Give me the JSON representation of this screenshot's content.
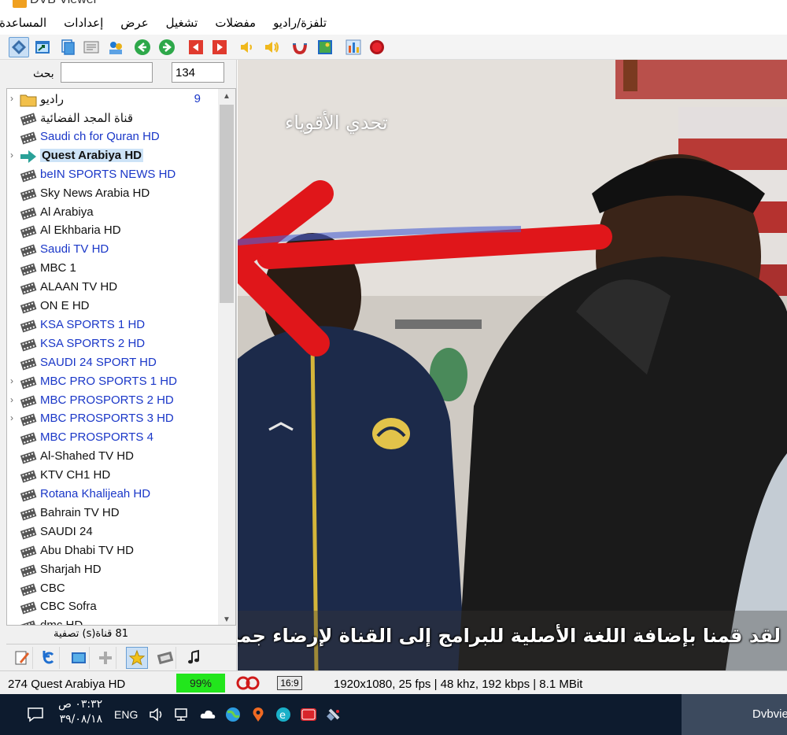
{
  "window": {
    "title": "DVB Viewer"
  },
  "menu": {
    "items": [
      "تلفزة/راديو",
      "مفضلات",
      "تشغيل",
      "عرض",
      "إعدادات",
      "المساعدة"
    ]
  },
  "toolbar": {
    "buttons": [
      {
        "icon": "channel-list-icon"
      },
      {
        "icon": "window-icon"
      },
      {
        "icon": "copy-icon"
      },
      {
        "icon": "teletext-icon"
      },
      {
        "icon": "users-icon"
      },
      {
        "icon": "back-icon"
      },
      {
        "icon": "forward-icon"
      },
      {
        "icon": "previous-icon"
      },
      {
        "icon": "next-icon"
      },
      {
        "icon": "volume-down-icon"
      },
      {
        "icon": "volume-up-icon"
      },
      {
        "icon": "magnet-icon"
      },
      {
        "icon": "picture-icon"
      },
      {
        "icon": "equalizer-icon"
      },
      {
        "icon": "record-icon"
      }
    ]
  },
  "search": {
    "label": "بحث",
    "value": "",
    "count_value": "134"
  },
  "channels": {
    "folder": {
      "name": "راديو",
      "count": "9"
    },
    "items": [
      {
        "name": "قناة المجد الفضائية",
        "color": "black",
        "arrow": false,
        "selected": false
      },
      {
        "name": "Saudi ch for Quran HD",
        "color": "blue",
        "arrow": false,
        "selected": false
      },
      {
        "name": "Quest Arabiya HD",
        "color": "black",
        "arrow": true,
        "selected": true
      },
      {
        "name": "beIN SPORTS NEWS HD",
        "color": "blue",
        "arrow": false,
        "selected": false
      },
      {
        "name": "Sky News Arabia HD",
        "color": "black",
        "arrow": false,
        "selected": false
      },
      {
        "name": "Al Arabiya",
        "color": "black",
        "arrow": false,
        "selected": false
      },
      {
        "name": "Al Ekhbaria HD",
        "color": "black",
        "arrow": false,
        "selected": false
      },
      {
        "name": "Saudi TV HD",
        "color": "blue",
        "arrow": false,
        "selected": false
      },
      {
        "name": "MBC 1",
        "color": "black",
        "arrow": false,
        "selected": false
      },
      {
        "name": "ALAAN TV HD",
        "color": "black",
        "arrow": false,
        "selected": false
      },
      {
        "name": "ON  E HD",
        "color": "black",
        "arrow": false,
        "selected": false
      },
      {
        "name": "KSA SPORTS 1 HD",
        "color": "blue",
        "arrow": false,
        "selected": false
      },
      {
        "name": "KSA SPORTS 2 HD",
        "color": "blue",
        "arrow": false,
        "selected": false
      },
      {
        "name": "SAUDI 24 SPORT HD",
        "color": "blue",
        "arrow": false,
        "selected": false
      },
      {
        "name": "MBC PRO SPORTS 1 HD",
        "color": "blue",
        "arrow": true,
        "selected": false
      },
      {
        "name": "MBC PROSPORTS 2 HD",
        "color": "blue",
        "arrow": true,
        "selected": false
      },
      {
        "name": "MBC PROSPORTS 3 HD",
        "color": "blue",
        "arrow": true,
        "selected": false
      },
      {
        "name": "MBC PROSPORTS 4",
        "color": "blue",
        "arrow": false,
        "selected": false
      },
      {
        "name": "Al-Shahed TV HD",
        "color": "black",
        "arrow": false,
        "selected": false
      },
      {
        "name": "KTV CH1 HD",
        "color": "black",
        "arrow": false,
        "selected": false
      },
      {
        "name": "Rotana Khalijeah HD",
        "color": "blue",
        "arrow": false,
        "selected": false
      },
      {
        "name": "Bahrain TV HD",
        "color": "black",
        "arrow": false,
        "selected": false
      },
      {
        "name": "SAUDI 24",
        "color": "black",
        "arrow": false,
        "selected": false
      },
      {
        "name": "Abu Dhabi TV HD",
        "color": "black",
        "arrow": false,
        "selected": false
      },
      {
        "name": "Sharjah HD",
        "color": "black",
        "arrow": false,
        "selected": false
      },
      {
        "name": "CBC",
        "color": "black",
        "arrow": false,
        "selected": false
      },
      {
        "name": "CBC Sofra",
        "color": "black",
        "arrow": false,
        "selected": false
      },
      {
        "name": "dmc HD",
        "color": "black",
        "arrow": false,
        "selected": false
      }
    ]
  },
  "filter": {
    "text": "81 قناة(s)   تصفية"
  },
  "bottom_toolbar": {
    "buttons": [
      {
        "icon": "edit-icon"
      },
      {
        "icon": "refresh-icon"
      },
      {
        "icon": "tv-list-icon"
      },
      {
        "icon": "add-icon"
      },
      {
        "icon": "star-icon"
      },
      {
        "icon": "film-icon"
      },
      {
        "icon": "music-icon"
      }
    ]
  },
  "video": {
    "overlay_title": "تحدي الأقوياء",
    "subtitle": "لقد قمنا بإضافة اللغة الأصلية للبرامج إلى القناة لإرضاء جميع"
  },
  "status": {
    "channel": "274 Quest Arabiya HD",
    "signal": "99%",
    "aspect": "16:9",
    "info": "1920x1080, 25 fps | 48 khz, 192 kbps | 8.1 MBit"
  },
  "taskbar": {
    "time": "٠٣:٣٢ ص",
    "date": "٣٩/٠٨/١٨",
    "lang": "ENG",
    "app": "Dvbviewer"
  }
}
